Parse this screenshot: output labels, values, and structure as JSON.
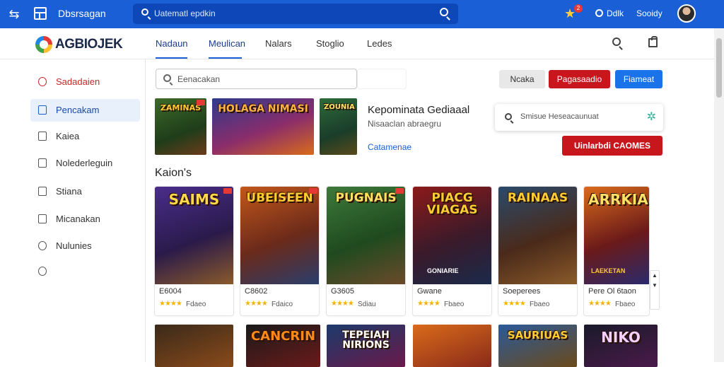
{
  "topbar": {
    "title": "Dbsrsagan",
    "search_placeholder": "Uatematl epdkin",
    "notification_count": "2",
    "right_label_1": "Ddlk",
    "right_label_2": "Sooidy"
  },
  "header": {
    "logo": "AGBIOJEK",
    "tabs": [
      {
        "label": "Nadaun"
      },
      {
        "label": "Meulican"
      },
      {
        "label": "Nalars"
      },
      {
        "label": "Stoglio"
      },
      {
        "label": "Ledes"
      }
    ]
  },
  "sidebar": {
    "items": [
      {
        "label": "Sadadaien",
        "icon": "person-icon"
      },
      {
        "label": "Pencakam",
        "icon": "calendar-icon"
      },
      {
        "label": "Kaiea",
        "icon": "document-icon"
      },
      {
        "label": "Nolederleguin",
        "icon": "chat-icon"
      },
      {
        "label": "Stiana",
        "icon": "file-icon"
      },
      {
        "label": "Micanakan",
        "icon": "page-icon"
      },
      {
        "label": "Nulunies",
        "icon": "help-icon"
      },
      {
        "label": "",
        "icon": "clock-icon"
      }
    ]
  },
  "filter": {
    "placeholder": "Eenacakan"
  },
  "buttons": {
    "grey": "Ncaka",
    "red": "Pagasaadio",
    "blue": "Fiameat"
  },
  "featured": {
    "title": "Kepominata Gediaaal",
    "subtitle": "Nisaaclan abraegru",
    "link": "Catamenae",
    "thumbs": [
      {
        "title": "ZAMINAS"
      },
      {
        "title": "HOLAGA NIMASI"
      },
      {
        "title": "ZOUNIA"
      }
    ]
  },
  "popup": {
    "text": "Smisue Heseacaunuat"
  },
  "cta": {
    "label": "Uinlarbdi  CAOMES"
  },
  "section": {
    "title": "Kaion's"
  },
  "games": [
    {
      "title": "SAIMS",
      "name": "E6004",
      "meta": "Fdaeo"
    },
    {
      "title": "UBEISEEN",
      "name": "C8602",
      "meta": "Fdaico"
    },
    {
      "title": "PUGNAIS",
      "name": "G3605",
      "meta": "Sdiau"
    },
    {
      "title": "PIACG VIAGAS",
      "name": "Gwane",
      "meta": "Fbaeo",
      "badge": "GONIARIE"
    },
    {
      "title": "RAINAAS",
      "name": "Soeperees",
      "meta": "Fbaeo"
    },
    {
      "title": "ARRKIA",
      "name": "Pere Ol 6taon",
      "meta": "Fbaeo",
      "badge": "LAEKETAN"
    }
  ],
  "games_row2": [
    {
      "title": ""
    },
    {
      "title": "CANCRIN"
    },
    {
      "title": "TEPEIAH NIRIONS"
    },
    {
      "title": ""
    },
    {
      "title": "SAURIUAS"
    },
    {
      "title": "NIKO"
    }
  ],
  "colors": {
    "topbar": "#1a5fd6",
    "brand_red": "#c8161d",
    "brand_blue": "#1a73e8",
    "star": "#f4b400"
  }
}
